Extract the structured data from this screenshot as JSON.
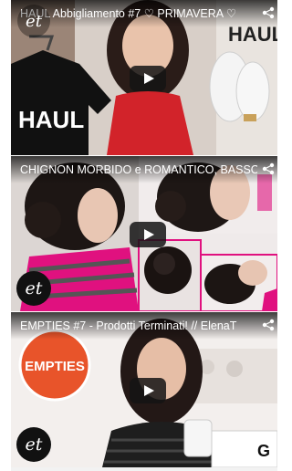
{
  "videos": [
    {
      "title": "HAUL Abbigliamento #7 ♡ PRIMAVERA ♡",
      "play_icon": "play-icon",
      "share_icon": "share-icon",
      "channel_logo": "et"
    },
    {
      "title": "CHIGNON MORBIDO e ROMANTICO, BASSO",
      "play_icon": "play-icon",
      "share_icon": "share-icon",
      "channel_logo": "et"
    },
    {
      "title": "EMPTIES #7 - Prodotti Terminati! // ElenaT",
      "play_icon": "play-icon",
      "share_icon": "share-icon",
      "channel_logo": "et"
    }
  ],
  "thumbnail_text": {
    "haul_shirt": "HAUL",
    "haul_box": "HAUL",
    "empties_badge": "EMPTIES"
  },
  "colors": {
    "youtube_red": "#e52d27",
    "accent_pink": "#e6007e",
    "empties_orange": "#e8542a"
  }
}
